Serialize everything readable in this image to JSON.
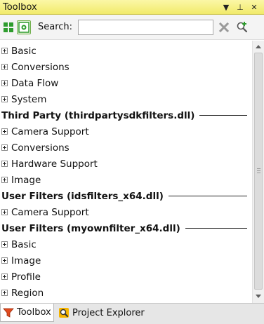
{
  "window": {
    "title": "Toolbox",
    "controls": {
      "dropdown": "▼",
      "pin": "⊥",
      "close": "✕"
    }
  },
  "toolbar": {
    "search_label": "Search:",
    "search_value": "",
    "search_placeholder": ""
  },
  "list": [
    {
      "type": "item",
      "label": "Basic"
    },
    {
      "type": "item",
      "label": "Conversions"
    },
    {
      "type": "item",
      "label": "Data Flow"
    },
    {
      "type": "item",
      "label": "System"
    },
    {
      "type": "group",
      "label": "Third Party (thirdpartysdkfilters.dll)"
    },
    {
      "type": "item",
      "label": "Camera Support"
    },
    {
      "type": "item",
      "label": "Conversions"
    },
    {
      "type": "item",
      "label": "Hardware Support"
    },
    {
      "type": "item",
      "label": "Image"
    },
    {
      "type": "group",
      "label": "User Filters (idsfilters_x64.dll)"
    },
    {
      "type": "item",
      "label": "Camera Support"
    },
    {
      "type": "group",
      "label": "User Filters (myownfilter_x64.dll)"
    },
    {
      "type": "item",
      "label": "Basic"
    },
    {
      "type": "item",
      "label": "Image"
    },
    {
      "type": "item",
      "label": "Profile"
    },
    {
      "type": "item",
      "label": "Region"
    }
  ],
  "tabs": [
    {
      "label": "Toolbox",
      "active": true
    },
    {
      "label": "Project Explorer",
      "active": false
    }
  ],
  "colors": {
    "title_bar": "#f1ea6a",
    "accent_green": "#2e9c2e"
  }
}
